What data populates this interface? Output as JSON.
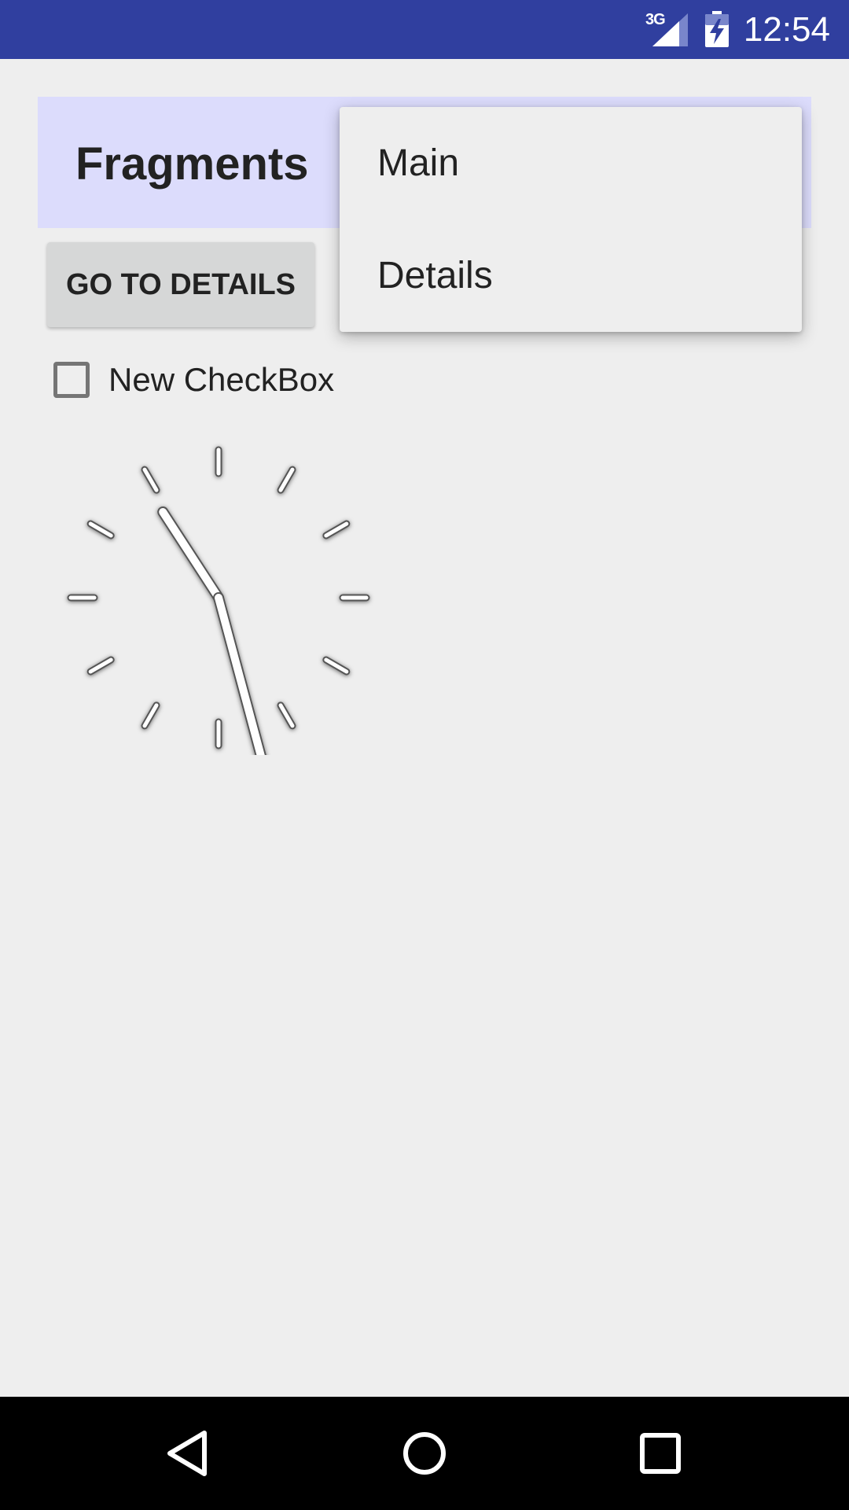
{
  "status_bar": {
    "network": "3G",
    "time": "12:54",
    "background_color": "#303f9f",
    "icons": [
      "signal-icon",
      "battery-charging-icon"
    ]
  },
  "header": {
    "title": "Fragments",
    "background_color": "#dcdcfc"
  },
  "main": {
    "details_button_label": "GO TO DETAILS",
    "checkbox": {
      "label": "New CheckBox",
      "checked": false
    },
    "analog_clock": {
      "hour_hand_position": 10.9,
      "minute_hand_position": 5.5
    }
  },
  "menu": {
    "items": [
      {
        "label": "Main"
      },
      {
        "label": "Details"
      }
    ]
  },
  "nav_bar": {
    "icons": [
      "back-icon",
      "home-icon",
      "recents-icon"
    ]
  }
}
